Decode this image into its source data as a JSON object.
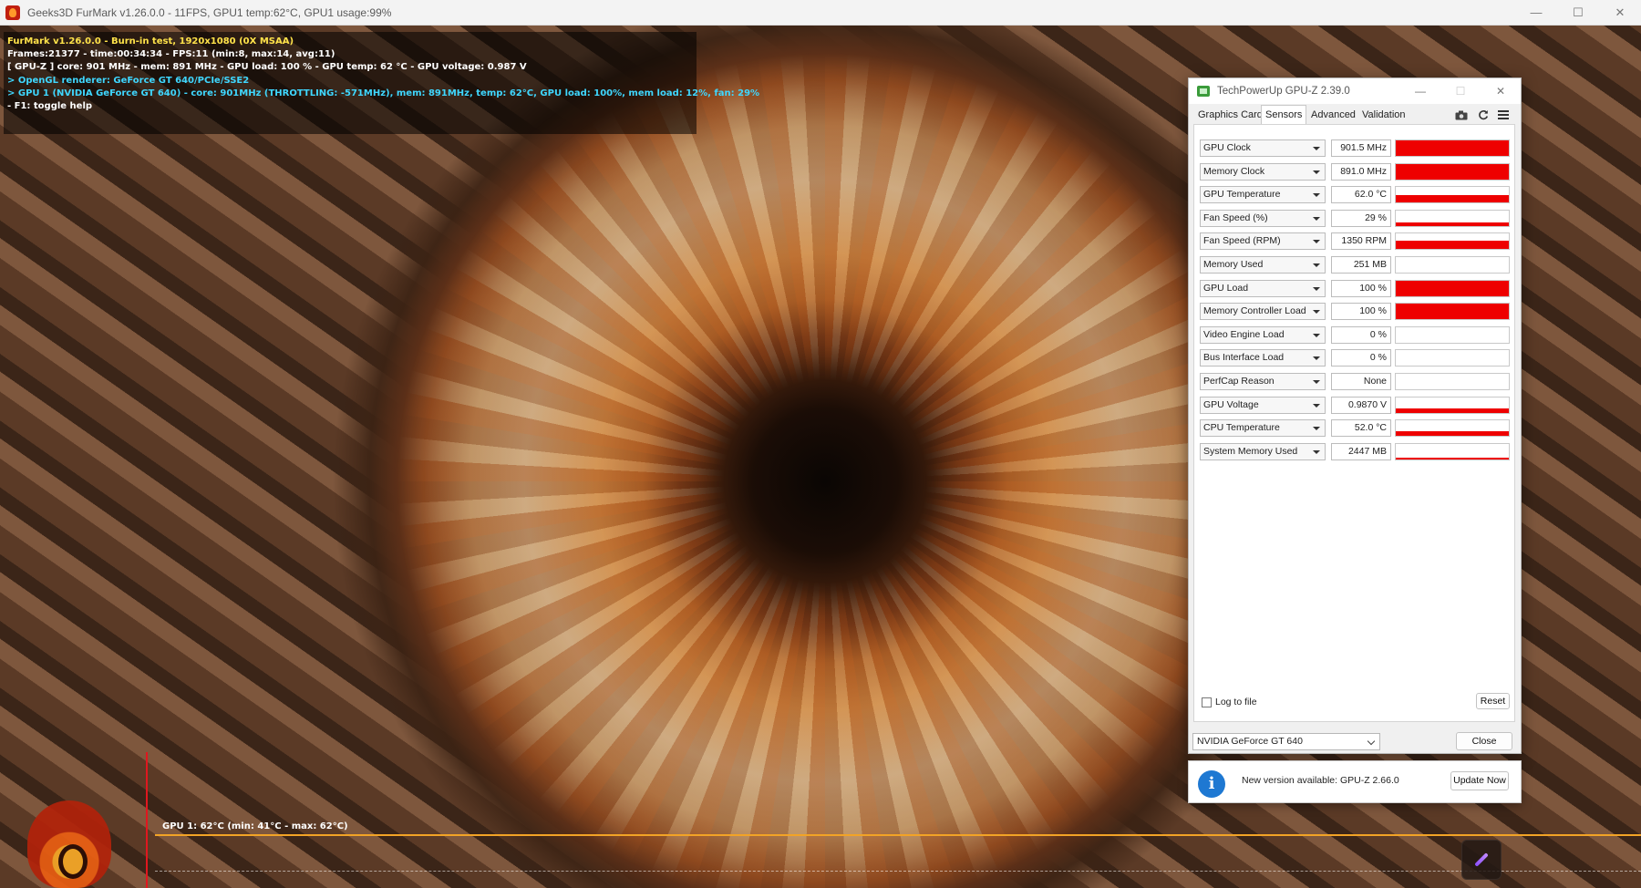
{
  "window": {
    "title": "Geeks3D FurMark v1.26.0.0 - 11FPS, GPU1 temp:62°C, GPU1 usage:99%",
    "controls": {
      "minimize": "—",
      "maximize": "☐",
      "close": "✕"
    }
  },
  "osd": {
    "line1": "FurMark v1.26.0.0 - Burn-in test, 1920x1080 (0X MSAA)",
    "line2": "Frames:21377 - time:00:34:34 - FPS:11 (min:8, max:14, avg:11)",
    "line3": "[ GPU-Z ] core: 901 MHz - mem: 891 MHz - GPU load: 100 % - GPU temp: 62 °C - GPU voltage: 0.987 V",
    "line4": "> OpenGL renderer: GeForce GT 640/PCIe/SSE2",
    "line5": "> GPU 1 (NVIDIA GeForce GT 640) - core: 901MHz (THROTTLING: -571MHz), mem: 891MHz, temp: 62°C, GPU load: 100%, mem load: 12%, fan: 29%",
    "line6": "- F1: toggle help"
  },
  "graph": {
    "label": "GPU 1: 62°C (min: 41°C - max: 62°C)"
  },
  "gpuz": {
    "title": "TechPowerUp GPU-Z 2.39.0",
    "controls": {
      "minimize": "—",
      "maximize": "☐",
      "close": "✕"
    },
    "tabs": {
      "graphics_card": "Graphics Card",
      "sensors": "Sensors",
      "advanced": "Advanced",
      "validation": "Validation"
    },
    "sensors": [
      {
        "name": "GPU Clock",
        "value": "901.5 MHz",
        "level": 1.0
      },
      {
        "name": "Memory Clock",
        "value": "891.0 MHz",
        "level": 1.0
      },
      {
        "name": "GPU Temperature",
        "value": "62.0 °C",
        "level": 0.5
      },
      {
        "name": "Fan Speed (%)",
        "value": "29 %",
        "level": 0.2
      },
      {
        "name": "Fan Speed (RPM)",
        "value": "1350 RPM",
        "level": 0.55
      },
      {
        "name": "Memory Used",
        "value": "251 MB",
        "level": 0.0
      },
      {
        "name": "GPU Load",
        "value": "100 %",
        "level": 1.0
      },
      {
        "name": "Memory Controller Load",
        "value": "100 %",
        "level": 1.0
      },
      {
        "name": "Video Engine Load",
        "value": "0 %",
        "level": 0.0
      },
      {
        "name": "Bus Interface Load",
        "value": "0 %",
        "level": 0.0
      },
      {
        "name": "PerfCap Reason",
        "value": "None",
        "level": 0.0
      },
      {
        "name": "GPU Voltage",
        "value": "0.9870 V",
        "level": 0.28
      },
      {
        "name": "CPU Temperature",
        "value": "52.0 °C",
        "level": 0.3
      },
      {
        "name": "System Memory Used",
        "value": "2447 MB",
        "level": 0.12
      }
    ],
    "log_to_file": "Log to file",
    "reset_button": "Reset",
    "gpu_select": "NVIDIA GeForce GT 640",
    "close_button": "Close",
    "bar_color": "#ee0000"
  },
  "notice": {
    "icon": "i",
    "message": "New version available: GPU-Z 2.66.0",
    "update_button": "Update Now"
  }
}
